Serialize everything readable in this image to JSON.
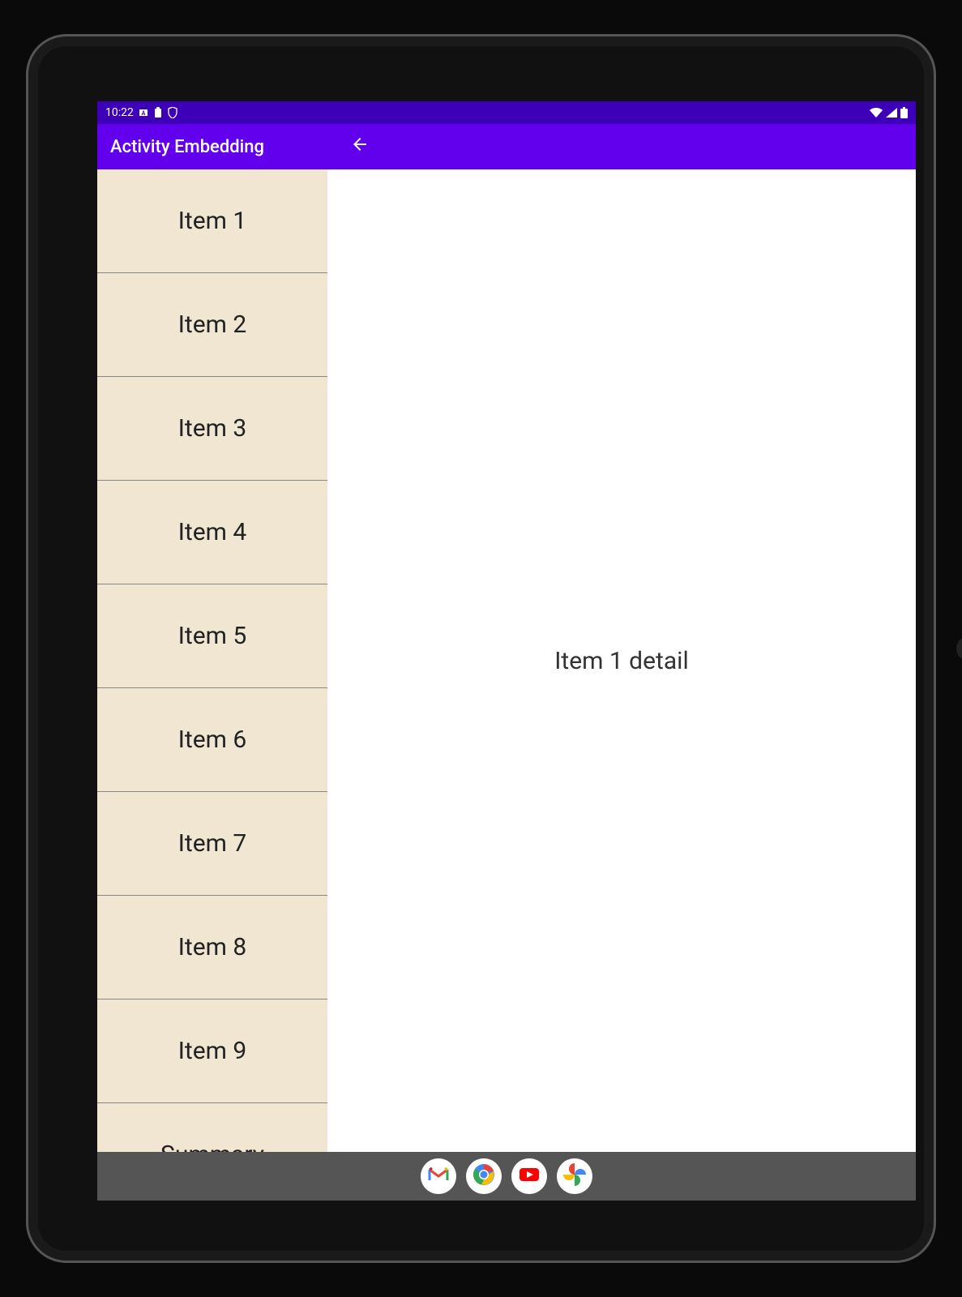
{
  "status_bar": {
    "time": "10:22",
    "icons_left": [
      "keyboard-icon",
      "clipboard-icon",
      "shield-icon"
    ],
    "icons_right": [
      "wifi-icon",
      "signal-icon",
      "battery-icon"
    ]
  },
  "app_bar": {
    "title": "Activity Embedding",
    "back_icon": "arrow-back-icon"
  },
  "list": {
    "items": [
      {
        "label": "Item 1"
      },
      {
        "label": "Item 2"
      },
      {
        "label": "Item 3"
      },
      {
        "label": "Item 4"
      },
      {
        "label": "Item 5"
      },
      {
        "label": "Item 6"
      },
      {
        "label": "Item 7"
      },
      {
        "label": "Item 8"
      },
      {
        "label": "Item 9"
      },
      {
        "label": "Summary"
      }
    ]
  },
  "detail": {
    "text": "Item 1 detail"
  },
  "dock": {
    "apps": [
      {
        "name": "gmail-icon"
      },
      {
        "name": "chrome-icon"
      },
      {
        "name": "youtube-icon"
      },
      {
        "name": "photos-icon"
      }
    ]
  },
  "colors": {
    "primary": "#6200ee",
    "primary_dark": "#3d00b8",
    "list_bg": "#f0e6d2"
  }
}
